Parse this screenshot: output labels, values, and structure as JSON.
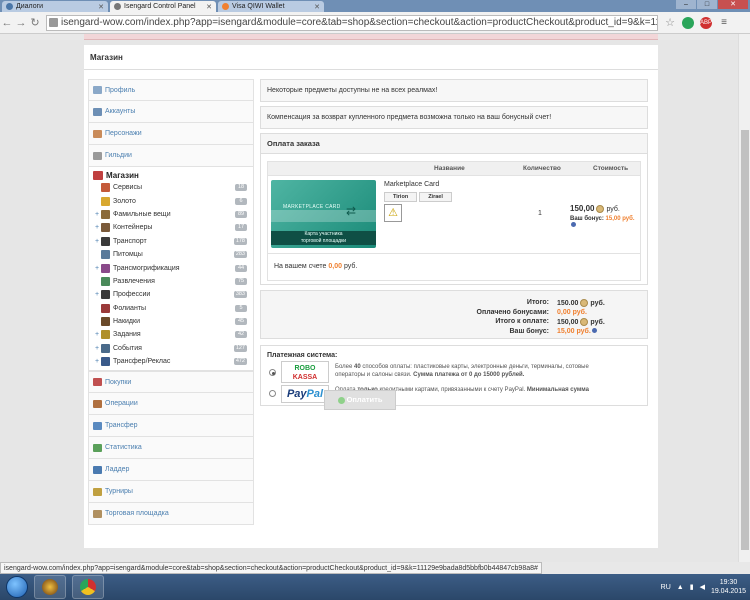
{
  "browser": {
    "tabs": [
      {
        "title": "Диалоги",
        "color": "#4a76a8"
      },
      {
        "title": "Isengard Control Panel",
        "color": "#777777"
      },
      {
        "title": "Visa QIWI Wallet",
        "color": "#f08030"
      }
    ],
    "url": "isengard-wow.com/index.php?app=isengard&module=core&tab=shop&section=checkout&action=productCheckout&product_id=9&k=1112",
    "status_url": "isengard-wow.com/index.php?app=isengard&module=core&tab=shop&section=checkout&action=productCheckout&product_id=9&k=11129e9bada8d5bbfb0b44847cb98a8#",
    "ext_abp": "ABP"
  },
  "page": {
    "title": "Магазин"
  },
  "sidebar": {
    "top": [
      {
        "label": "Профиль",
        "icon": "profile-icon",
        "color": "#8aa8c8"
      },
      {
        "label": "Аккаунты",
        "icon": "accounts-icon",
        "color": "#6d8fb5"
      },
      {
        "label": "Персонажи",
        "icon": "characters-icon",
        "color": "#c98b5a"
      },
      {
        "label": "Гильдии",
        "icon": "guilds-icon",
        "color": "#9a9a9a"
      }
    ],
    "shop_title": "Магазин",
    "shop_items": [
      {
        "label": "Сервисы",
        "count": "18",
        "expand": "",
        "color": "#c45a3a"
      },
      {
        "label": "Золото",
        "count": "6",
        "expand": "",
        "color": "#d8a830"
      },
      {
        "label": "Фамильные вещи",
        "count": "89",
        "expand": "+",
        "color": "#8a6a3a"
      },
      {
        "label": "Контейнеры",
        "count": "17",
        "expand": "+",
        "color": "#7a5a3a"
      },
      {
        "label": "Транспорт",
        "count": "178",
        "expand": "+",
        "color": "#3a3a3a"
      },
      {
        "label": "Питомцы",
        "count": "283",
        "expand": "",
        "color": "#5a7a9a"
      },
      {
        "label": "Трансмогрификация",
        "count": "44",
        "expand": "+",
        "color": "#8a4a8a"
      },
      {
        "label": "Развлечения",
        "count": "75",
        "expand": "",
        "color": "#4a8a5a"
      },
      {
        "label": "Профессии",
        "count": "383",
        "expand": "+",
        "color": "#3a3a3a"
      },
      {
        "label": "Фолианты",
        "count": "5",
        "expand": "",
        "color": "#9a3a3a"
      },
      {
        "label": "Накидки",
        "count": "45",
        "expand": "",
        "color": "#6a4a2a"
      },
      {
        "label": "Задания",
        "count": "42",
        "expand": "+",
        "color": "#b0902a"
      },
      {
        "label": "События",
        "count": "127",
        "expand": "+",
        "color": "#4a6a8a"
      },
      {
        "label": "Трансфер/Реклас",
        "count": "472",
        "expand": "+",
        "color": "#3a5a8a"
      }
    ],
    "bottom": [
      {
        "label": "Покупки",
        "icon": "purchases-icon",
        "color": "#c05050"
      },
      {
        "label": "Операции",
        "icon": "operations-icon",
        "color": "#b07040"
      },
      {
        "label": "Трансфер",
        "icon": "transfer-icon",
        "color": "#5a8ac0"
      },
      {
        "label": "Статистика",
        "icon": "statistics-icon",
        "color": "#5aa05a"
      },
      {
        "label": "Ладдер",
        "icon": "ladder-icon",
        "color": "#4a7ab0"
      },
      {
        "label": "Турниры",
        "icon": "tournaments-icon",
        "color": "#c0a040"
      },
      {
        "label": "Торговая площадка",
        "icon": "marketplace-icon",
        "color": "#b09060"
      }
    ]
  },
  "notices": [
    "Некоторые предметы доступны не на всех реалмах!",
    "Компенсация за возврат купленного предмета возможна только на ваш бонусный счет!"
  ],
  "order": {
    "title": "Оплата заказа",
    "columns": {
      "name": "Название",
      "qty": "Количество",
      "cost": "Стоимость"
    },
    "card_top": "MARKETPLACE CARD",
    "card_caption_1": "Карта участника",
    "card_caption_2": "торговой площадки",
    "product_name": "Marketplace Card",
    "realms": [
      "Tirion",
      "Zirael"
    ],
    "qty": "1",
    "price": "150,00",
    "currency": "руб.",
    "bonus_label": "Ваш бонус:",
    "bonus_value": "15,00 руб.",
    "balance_label": "На вашем счете",
    "balance_value": "0,00",
    "balance_currency": "руб."
  },
  "totals": [
    {
      "label": "Итого:",
      "value": "150.00",
      "cur": "руб.",
      "coin": true,
      "accent": false,
      "info": false
    },
    {
      "label": "Оплачено бонусами:",
      "value": "0,00",
      "cur": "руб.",
      "coin": false,
      "accent": true,
      "info": false
    },
    {
      "label": "Итого к оплате:",
      "value": "150,00",
      "cur": "руб.",
      "coin": true,
      "accent": false,
      "info": false
    },
    {
      "label": "Ваш бонус:",
      "value": "15,00",
      "cur": "руб.",
      "coin": false,
      "accent": true,
      "info": true
    }
  ],
  "payment": {
    "title": "Платежная система:",
    "robo_1": "ROBO",
    "robo_2": "KASSA",
    "paypal_1": "Pay",
    "paypal_2": "Pal",
    "robo_desc_a": "Более ",
    "robo_desc_b": "40",
    "robo_desc_c": " способов оплаты: пластиковые карты, электронные деньги, терминалы, сотовые операторы и салоны связи. ",
    "robo_desc_d": "Сумма платежа от 0 до 15000 рублей.",
    "paypal_desc_a": "Оплата ",
    "paypal_desc_b": "только",
    "paypal_desc_c": " кредитными картами, привязанными к счету PayPal. ",
    "paypal_desc_d": "Минимальная сумма платежа 50 рублей."
  },
  "pay_button": "Оплатить",
  "taskbar": {
    "lang": "RU",
    "time": "19:30",
    "date": "19.04.2015"
  },
  "colors": {
    "accent": "#f08030",
    "link": "#4b7fb0"
  }
}
